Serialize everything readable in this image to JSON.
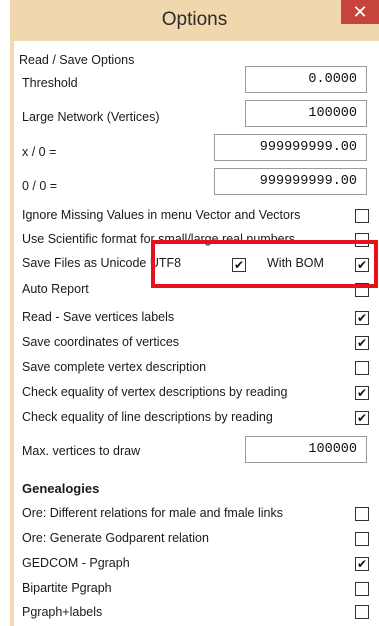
{
  "window": {
    "title": "Options",
    "close_glyph": "✕"
  },
  "read_save_group": "Read / Save Options",
  "fields": {
    "threshold": {
      "label": "Threshold",
      "value": "0.0000"
    },
    "large_network": {
      "label": "Large Network (Vertices)",
      "value": "100000"
    },
    "x_div_0": {
      "label": "x / 0 =",
      "value": "999999999.00"
    },
    "zero_div_0": {
      "label": "0 / 0 =",
      "value": "999999999.00"
    },
    "max_vertices": {
      "label": "Max. vertices to draw",
      "value": "100000"
    }
  },
  "options": [
    {
      "label": "Ignore Missing Values in menu Vector and Vectors",
      "checked": false
    },
    {
      "label": "Use Scientific format for small/large real numbers",
      "checked": false
    },
    {
      "label": "Save Files as Unicode UTF8",
      "checked": true
    },
    {
      "label": "Auto Report",
      "checked": false
    },
    {
      "label": "Read - Save vertices labels",
      "checked": true
    },
    {
      "label": "Save coordinates of vertices",
      "checked": true
    },
    {
      "label": "Save complete vertex description",
      "checked": false
    },
    {
      "label": "Check equality of vertex descriptions by reading",
      "checked": true
    },
    {
      "label": "Check equality of line descriptions by reading",
      "checked": true
    }
  ],
  "with_bom": {
    "label": "With BOM",
    "checked": true
  },
  "genealogies": {
    "title": "Genealogies",
    "items": [
      {
        "label": "Ore: Different relations for male and fmale links",
        "checked": false
      },
      {
        "label": "Ore: Generate Godparent relation",
        "checked": false
      },
      {
        "label": "GEDCOM - Pgraph",
        "checked": true
      },
      {
        "label": "Bipartite Pgraph",
        "checked": false
      },
      {
        "label": "Pgraph+labels",
        "checked": false
      }
    ]
  },
  "check_glyph": "✔",
  "colors": {
    "titlebar": "#f1d7ad",
    "close_button": "#c7443d",
    "highlight_box": "#e8101a"
  }
}
